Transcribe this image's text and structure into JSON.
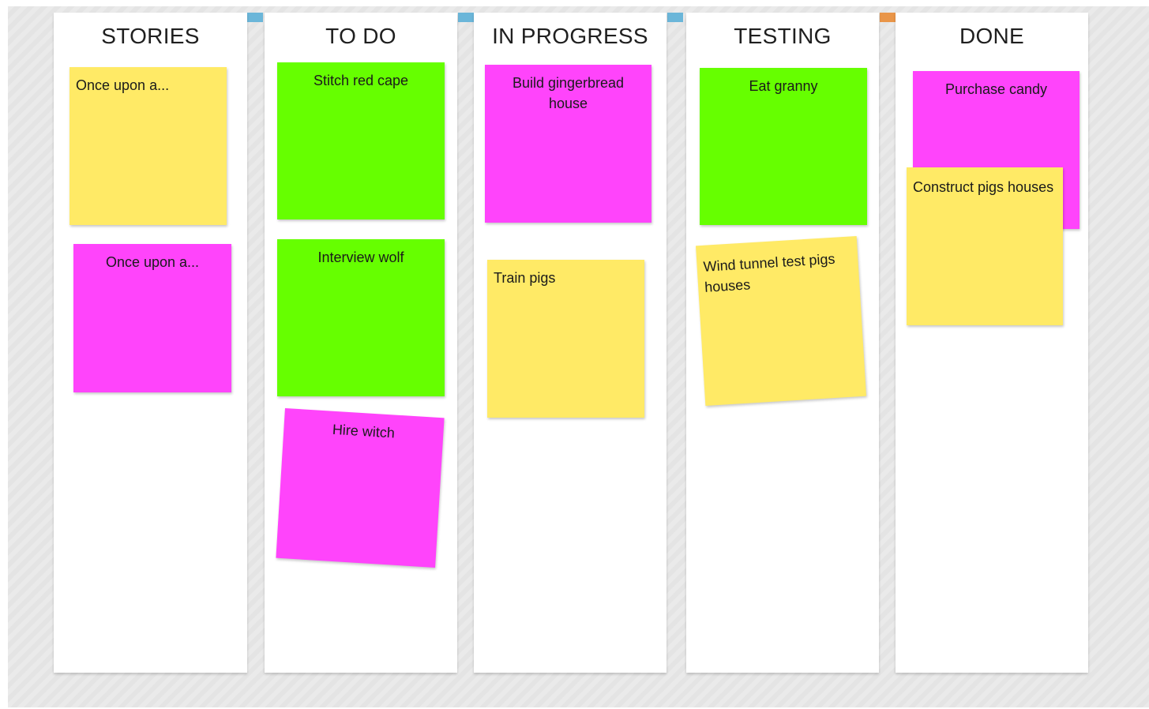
{
  "colors": {
    "yellow": "#ffea66",
    "magenta": "#ff44fb",
    "green": "#66ff00",
    "tab_blue": "#6bb6d9",
    "tab_orange": "#e99548"
  },
  "columns": [
    {
      "title": "STORIES"
    },
    {
      "title": "TO DO"
    },
    {
      "title": "IN PROGRESS"
    },
    {
      "title": "TESTING"
    },
    {
      "title": "DONE"
    }
  ],
  "notes": {
    "stories_1": "Once upon a...",
    "stories_2": "Once upon a...",
    "todo_1": "Stitch red cape",
    "todo_2": "Interview wolf",
    "todo_3": "Hire witch",
    "progress_1": "Build gingerbread house",
    "progress_2": "Train pigs",
    "testing_1": "Eat granny",
    "testing_2": "Wind tunnel test pigs houses",
    "done_1": "Purchase candy",
    "done_2": "Construct pigs houses"
  }
}
